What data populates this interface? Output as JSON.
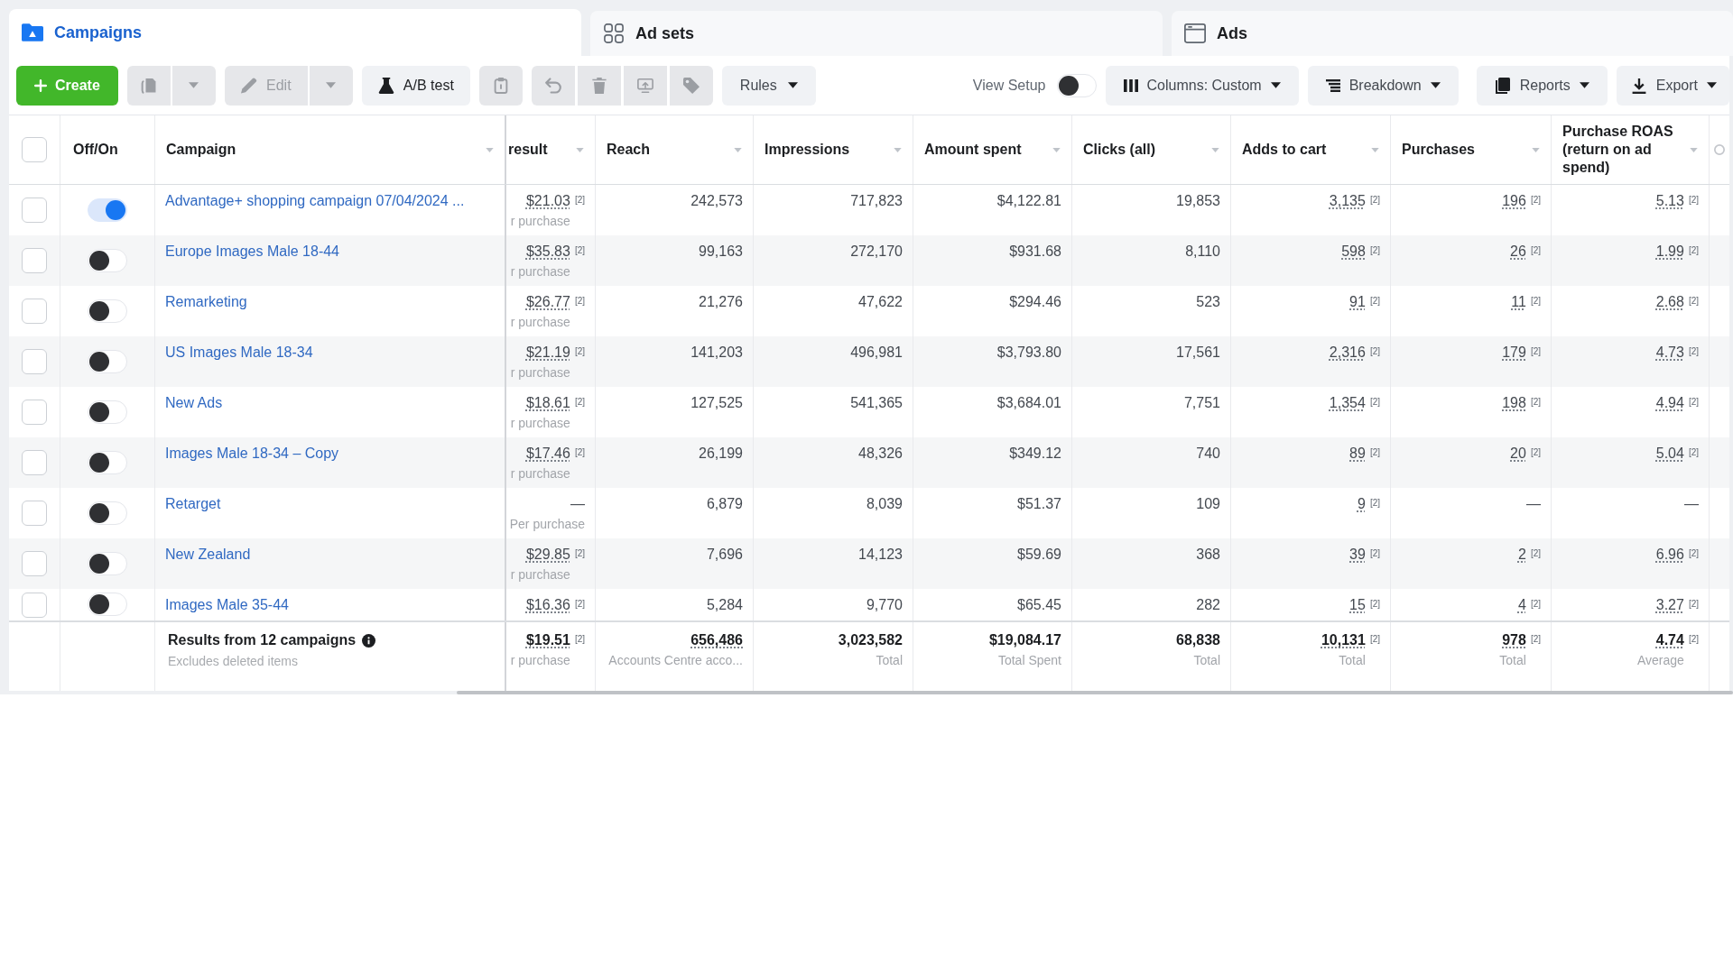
{
  "tabs": [
    {
      "kind": "campaigns",
      "label": "Campaigns",
      "selected": true
    },
    {
      "kind": "adsets",
      "label": "Ad sets",
      "selected": false
    },
    {
      "kind": "ads",
      "label": "Ads",
      "selected": false
    }
  ],
  "toolbar": {
    "actions": [
      {
        "kind": "create",
        "label": "Create",
        "disabled": false
      },
      {
        "kind": "duplicate",
        "disabled": true
      },
      {
        "kind": "edit",
        "label": "Edit",
        "disabled": true
      },
      {
        "kind": "ab_test",
        "label": "A/B test",
        "disabled": false
      },
      {
        "kind": "clipboard",
        "disabled": true
      },
      {
        "kind": "group",
        "items": [
          {
            "kind": "undo",
            "disabled": true
          },
          {
            "kind": "delete",
            "disabled": true
          },
          {
            "kind": "preview",
            "disabled": true
          },
          {
            "kind": "tag",
            "disabled": true
          }
        ]
      },
      {
        "kind": "rules",
        "label": "Rules",
        "disabled": false
      }
    ],
    "view_setup": {
      "label": "View Setup",
      "on": false
    },
    "menus": [
      {
        "kind": "columns",
        "label": "Columns: Custom"
      },
      {
        "kind": "breakdown",
        "label": "Breakdown"
      },
      {
        "kind": "reports",
        "label": "Reports"
      },
      {
        "kind": "export",
        "label": "Export"
      }
    ]
  },
  "table": {
    "select_all": {
      "checked": false
    },
    "toggle_header": {
      "label": "Off/On"
    },
    "name_header": {
      "label": "Campaign",
      "sortable": true
    },
    "columns": [
      {
        "label": "result",
        "sortable": true
      },
      {
        "label": "Reach",
        "sortable": true
      },
      {
        "label": "Impressions",
        "sortable": true
      },
      {
        "label": "Amount spent",
        "sortable": true
      },
      {
        "label": "Clicks (all)",
        "sortable": true
      },
      {
        "label": "Adds to cart",
        "sortable": true
      },
      {
        "label": "Purchases",
        "sortable": true
      },
      {
        "label": "Purchase ROAS (return on ad spend)",
        "sortable": true
      }
    ],
    "rows": [
      {
        "checked": false,
        "on": true,
        "name": "Advantage+ shopping campaign 07/04/2024 ...",
        "cells": [
          {
            "value": "$21.03",
            "underlined": true,
            "note": "[2]",
            "sub": "r purchase"
          },
          {
            "value": "242,573",
            "underlined": false
          },
          {
            "value": "717,823",
            "underlined": false
          },
          {
            "value": "$4,122.81",
            "underlined": false
          },
          {
            "value": "19,853",
            "underlined": false
          },
          {
            "value": "3,135",
            "underlined": true,
            "note": "[2]"
          },
          {
            "value": "196",
            "underlined": true,
            "note": "[2]"
          },
          {
            "value": "5.13",
            "underlined": true,
            "note": "[2]"
          }
        ]
      },
      {
        "checked": false,
        "on": false,
        "name": "Europe Images Male 18-44",
        "cells": [
          {
            "value": "$35.83",
            "underlined": true,
            "note": "[2]",
            "sub": "r purchase"
          },
          {
            "value": "99,163",
            "underlined": false
          },
          {
            "value": "272,170",
            "underlined": false
          },
          {
            "value": "$931.68",
            "underlined": false
          },
          {
            "value": "8,110",
            "underlined": false
          },
          {
            "value": "598",
            "underlined": true,
            "note": "[2]"
          },
          {
            "value": "26",
            "underlined": true,
            "note": "[2]"
          },
          {
            "value": "1.99",
            "underlined": true,
            "note": "[2]"
          }
        ]
      },
      {
        "checked": false,
        "on": false,
        "name": "Remarketing",
        "cells": [
          {
            "value": "$26.77",
            "underlined": true,
            "note": "[2]",
            "sub": "r purchase"
          },
          {
            "value": "21,276",
            "underlined": false
          },
          {
            "value": "47,622",
            "underlined": false
          },
          {
            "value": "$294.46",
            "underlined": false
          },
          {
            "value": "523",
            "underlined": false
          },
          {
            "value": "91",
            "underlined": true,
            "note": "[2]"
          },
          {
            "value": "11",
            "underlined": true,
            "note": "[2]"
          },
          {
            "value": "2.68",
            "underlined": true,
            "note": "[2]"
          }
        ]
      },
      {
        "checked": false,
        "on": false,
        "name": "US Images Male 18-34",
        "cells": [
          {
            "value": "$21.19",
            "underlined": true,
            "note": "[2]",
            "sub": "r purchase"
          },
          {
            "value": "141,203",
            "underlined": false
          },
          {
            "value": "496,981",
            "underlined": false
          },
          {
            "value": "$3,793.80",
            "underlined": false
          },
          {
            "value": "17,561",
            "underlined": false
          },
          {
            "value": "2,316",
            "underlined": true,
            "note": "[2]"
          },
          {
            "value": "179",
            "underlined": true,
            "note": "[2]"
          },
          {
            "value": "4.73",
            "underlined": true,
            "note": "[2]"
          }
        ]
      },
      {
        "checked": false,
        "on": false,
        "name": "New Ads",
        "cells": [
          {
            "value": "$18.61",
            "underlined": true,
            "note": "[2]",
            "sub": "r purchase"
          },
          {
            "value": "127,525",
            "underlined": false
          },
          {
            "value": "541,365",
            "underlined": false
          },
          {
            "value": "$3,684.01",
            "underlined": false
          },
          {
            "value": "7,751",
            "underlined": false
          },
          {
            "value": "1,354",
            "underlined": true,
            "note": "[2]"
          },
          {
            "value": "198",
            "underlined": true,
            "note": "[2]"
          },
          {
            "value": "4.94",
            "underlined": true,
            "note": "[2]"
          }
        ]
      },
      {
        "checked": false,
        "on": false,
        "name": "Images Male 18-34 – Copy",
        "cells": [
          {
            "value": "$17.46",
            "underlined": true,
            "note": "[2]",
            "sub": "r purchase"
          },
          {
            "value": "26,199",
            "underlined": false
          },
          {
            "value": "48,326",
            "underlined": false
          },
          {
            "value": "$349.12",
            "underlined": false
          },
          {
            "value": "740",
            "underlined": false
          },
          {
            "value": "89",
            "underlined": true,
            "note": "[2]"
          },
          {
            "value": "20",
            "underlined": true,
            "note": "[2]"
          },
          {
            "value": "5.04",
            "underlined": true,
            "note": "[2]"
          }
        ]
      },
      {
        "checked": false,
        "on": false,
        "name": "Retarget",
        "cells": [
          {
            "value": "—",
            "underlined": false,
            "sub": "Per purchase"
          },
          {
            "value": "6,879",
            "underlined": false
          },
          {
            "value": "8,039",
            "underlined": false
          },
          {
            "value": "$51.37",
            "underlined": false
          },
          {
            "value": "109",
            "underlined": false
          },
          {
            "value": "9",
            "underlined": true,
            "note": "[2]"
          },
          {
            "value": "—",
            "underlined": false
          },
          {
            "value": "—",
            "underlined": false
          }
        ]
      },
      {
        "checked": false,
        "on": false,
        "name": "New Zealand",
        "cells": [
          {
            "value": "$29.85",
            "underlined": true,
            "note": "[2]",
            "sub": "r purchase"
          },
          {
            "value": "7,696",
            "underlined": false
          },
          {
            "value": "14,123",
            "underlined": false
          },
          {
            "value": "$59.69",
            "underlined": false
          },
          {
            "value": "368",
            "underlined": false
          },
          {
            "value": "39",
            "underlined": true,
            "note": "[2]"
          },
          {
            "value": "2",
            "underlined": true,
            "note": "[2]"
          },
          {
            "value": "6.96",
            "underlined": true,
            "note": "[2]"
          }
        ]
      },
      {
        "checked": false,
        "on": false,
        "name": "Images Male 35-44",
        "cells": [
          {
            "value": "$16.36",
            "underlined": true,
            "note": "[2]"
          },
          {
            "value": "5,284",
            "underlined": false
          },
          {
            "value": "9,770",
            "underlined": false
          },
          {
            "value": "$65.45",
            "underlined": false
          },
          {
            "value": "282",
            "underlined": false
          },
          {
            "value": "15",
            "underlined": true,
            "note": "[2]"
          },
          {
            "value": "4",
            "underlined": true,
            "note": "[2]"
          },
          {
            "value": "3.27",
            "underlined": true,
            "note": "[2]"
          }
        ]
      }
    ],
    "footer": {
      "title": "Results from 12 campaigns",
      "subtitle": "Excludes deleted items",
      "cells": [
        {
          "value": "$19.51",
          "underlined": true,
          "note": "[2]",
          "sub": "r purchase"
        },
        {
          "value": "656,486",
          "underlined": true,
          "sub": "Accounts Centre acco..."
        },
        {
          "value": "3,023,582",
          "underlined": false,
          "sub": "Total"
        },
        {
          "value": "$19,084.17",
          "underlined": false,
          "sub": "Total Spent"
        },
        {
          "value": "68,838",
          "underlined": false,
          "sub": "Total"
        },
        {
          "value": "10,131",
          "underlined": true,
          "note": "[2]",
          "sub": "Total"
        },
        {
          "value": "978",
          "underlined": true,
          "note": "[2]",
          "sub": "Total"
        },
        {
          "value": "4.74",
          "underlined": true,
          "note": "[2]",
          "sub": "Average"
        }
      ]
    }
  }
}
